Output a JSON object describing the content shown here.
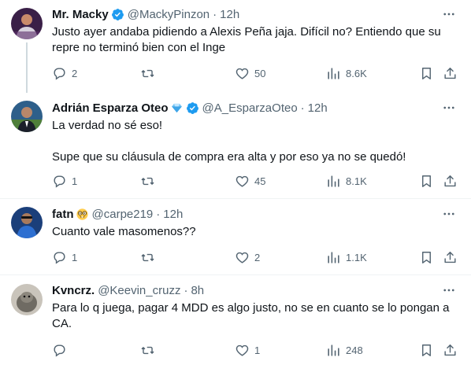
{
  "tweets": [
    {
      "name": "Mr. Macky",
      "handle": "@MackyPinzon",
      "time": "12h",
      "lines": [
        "Justo ayer andaba pidiendo a Alexis Peña jaja. Difícil no? Entiendo que su",
        "repre no terminó bien con el Inge"
      ],
      "replies": "2",
      "retweets": "",
      "likes": "50",
      "views": "8.6K"
    },
    {
      "name": "Adrián Esparza Oteo",
      "handle": "@A_EsparzaOteo",
      "time": "12h",
      "lines": [
        "La verdad no sé eso!",
        "",
        "Supe que su cláusula de compra era alta y por eso ya no se quedó!"
      ],
      "replies": "1",
      "retweets": "",
      "likes": "45",
      "views": "8.1K"
    },
    {
      "name": "fatn",
      "handle": "@carpe219",
      "time": "12h",
      "lines": [
        "Cuanto vale masomenos??"
      ],
      "replies": "1",
      "retweets": "",
      "likes": "2",
      "views": "1.1K"
    },
    {
      "name": "Kvncrz.",
      "handle": "@Keevin_cruzz",
      "time": "8h",
      "lines": [
        "Para lo q juega, pagar 4 MDD es algo justo, no se en cuanto se lo pongan a",
        "CA."
      ],
      "replies": "",
      "retweets": "",
      "likes": "1",
      "views": "248"
    }
  ],
  "separator": "·",
  "colors": {
    "text": "#0f1419",
    "secondary": "#536471",
    "verified": "#1d9bf0",
    "thread_line": "#cfd9de",
    "divider": "#eff3f4"
  },
  "icons": [
    "verified-badge-icon",
    "diamond-icon",
    "nerd-face-icon",
    "more-icon",
    "reply-icon",
    "retweet-icon",
    "like-icon",
    "views-icon",
    "bookmark-icon",
    "share-icon"
  ]
}
